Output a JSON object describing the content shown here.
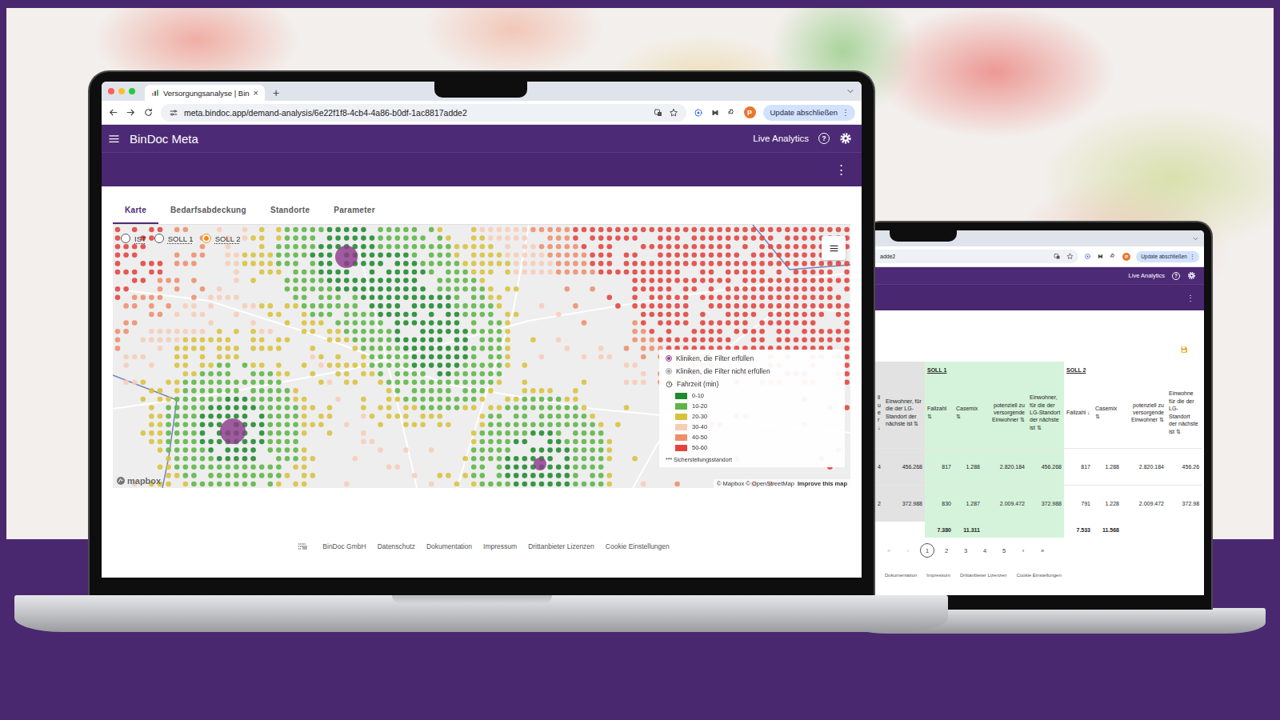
{
  "front": {
    "browser": {
      "tab_title": "Versorgungsanalyse | BinDoc",
      "tab_close": "×",
      "new_tab": "+",
      "url": "meta.bindoc.app/demand-analysis/6e22f1f8-4cb4-4a86-b0df-1ac8817adde2",
      "profile": "P",
      "update_button": "Update abschließen",
      "update_menu": "⋮"
    },
    "app_bar": {
      "title": "BinDoc Meta",
      "live": "Live Analytics",
      "help": "?",
      "menu": "⋮"
    },
    "tabs": [
      {
        "label": "Karte",
        "selected": true
      },
      {
        "label": "Bedarfsabdeckung",
        "selected": false
      },
      {
        "label": "Standorte",
        "selected": false
      },
      {
        "label": "Parameter",
        "selected": false
      }
    ],
    "scenarios": [
      {
        "label": "IST",
        "selected": false
      },
      {
        "label": "SOLL 1",
        "selected": false
      },
      {
        "label": "SOLL 2",
        "selected": true
      }
    ],
    "map": {
      "legend": {
        "clinics": [
          {
            "label": "Kliniken, die Filter erfüllen",
            "color": "#8e3b8c"
          },
          {
            "label": "Kliniken, die Filter nicht erfüllen",
            "color": "#9e9e9e"
          }
        ],
        "travel_title": "Fahrzeit (min)",
        "bins": [
          {
            "label": "0-10",
            "color": "#1e8a2e"
          },
          {
            "label": "10-20",
            "color": "#5cb545"
          },
          {
            "label": "20-30",
            "color": "#d8c23c"
          },
          {
            "label": "30-40",
            "color": "#f7cdb8"
          },
          {
            "label": "40-50",
            "color": "#ee8e6c"
          },
          {
            "label": "50-60",
            "color": "#e2433f"
          }
        ],
        "note": "*** Sicherstellungsstandort"
      },
      "logo": "mapbox",
      "attribution": "© Mapbox © OpenStreetMap",
      "improve": "Improve this map"
    },
    "footer": {
      "company": "BinDoc GmbH",
      "links": [
        "Datenschutz",
        "Dokumentation",
        "Impressum",
        "Drittanbieter Lizenzen",
        "Cookie Einstellungen"
      ]
    }
  },
  "back": {
    "browser": {
      "url": "adde2",
      "profile": "P",
      "update_button": "Update abschließen",
      "update_menu": "⋮"
    },
    "app_bar": {
      "live": "Live Analytics",
      "help": "?",
      "menu": "⋮"
    },
    "table": {
      "groups": [
        {
          "label": "",
          "span": 2,
          "color": "#e2e2e2"
        },
        {
          "label": "SOLL 1",
          "span": 4,
          "color": "#d5f3da"
        },
        {
          "label": "SOLL 2",
          "span": 4,
          "color": "#ffffff"
        }
      ],
      "columns": [
        "ll u e r ↓",
        "Einwohner, für die der LG-Standort der nächste ist ⇅",
        "Fallzahl ⇅",
        "Casemix ⇅",
        "potenziell zu versorgende Einwohner ⇅",
        "Einwohner, für die der LG-Standort der nächste ist ⇅",
        "Fallzahl ↓",
        "Casemix ⇅",
        "potenziell zu versorgende Einwohner ⇅",
        "Einwohne für die der LG- Standort der nächste ist ⇅"
      ],
      "rows": [
        [
          "4",
          "456.268",
          "817",
          "1.288",
          "2.820.184",
          "456.268",
          "817",
          "1.288",
          "2.820.184",
          "456.26"
        ],
        [
          "2",
          "372.988",
          "830",
          "1.287",
          "2.009.472",
          "372.988",
          "791",
          "1.228",
          "2.009.472",
          "372.98"
        ]
      ],
      "totals": [
        "",
        "",
        "7.380",
        "11.311",
        "",
        "",
        "7.533",
        "11.568",
        "",
        ""
      ]
    },
    "pagination": [
      {
        "label": "«",
        "selected": false,
        "disabled": true
      },
      {
        "label": "‹",
        "selected": false,
        "disabled": true
      },
      {
        "label": "1",
        "selected": true,
        "disabled": false
      },
      {
        "label": "2",
        "selected": false,
        "disabled": false
      },
      {
        "label": "3",
        "selected": false,
        "disabled": false
      },
      {
        "label": "4",
        "selected": false,
        "disabled": false
      },
      {
        "label": "5",
        "selected": false,
        "disabled": false
      },
      {
        "label": "›",
        "selected": false,
        "disabled": false
      },
      {
        "label": "»",
        "selected": false,
        "disabled": false
      }
    ],
    "footer": {
      "links": [
        "Dokumentation",
        "Impressum",
        "Drittanbieter Lizenzen",
        "Cookie Einstellungen"
      ]
    }
  }
}
